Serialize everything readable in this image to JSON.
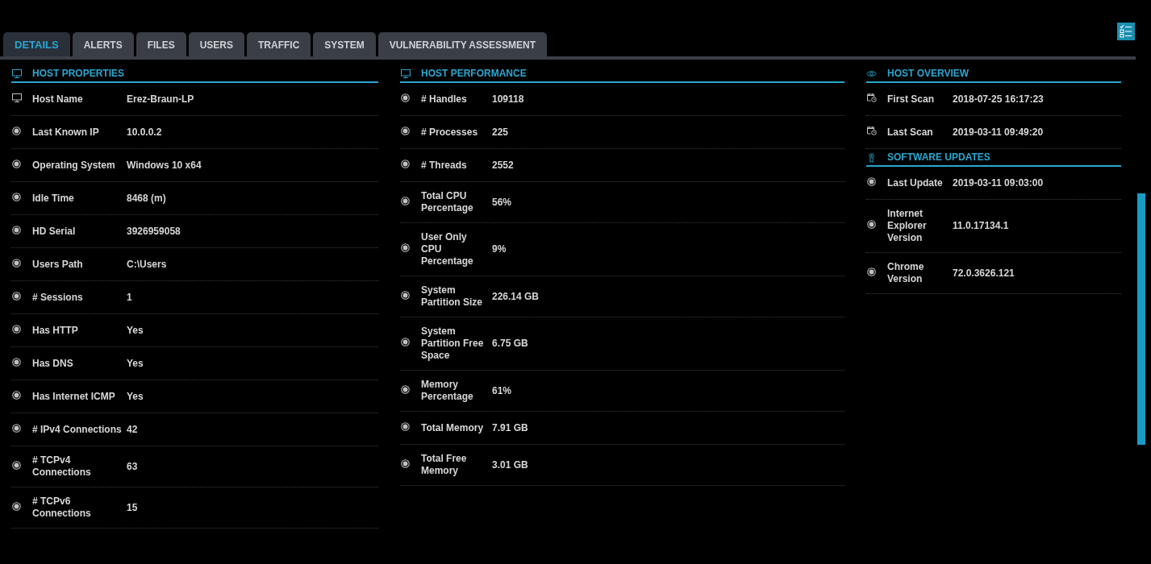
{
  "tabs": [
    {
      "label": "DETAILS",
      "selected": true
    },
    {
      "label": "ALERTS",
      "selected": false
    },
    {
      "label": "FILES",
      "selected": false
    },
    {
      "label": "USERS",
      "selected": false
    },
    {
      "label": "TRAFFIC",
      "selected": false
    },
    {
      "label": "SYSTEM",
      "selected": false
    },
    {
      "label": "VULNERABILITY ASSESSMENT",
      "selected": false
    }
  ],
  "columns": [
    {
      "sections": [
        {
          "title": "HOST PROPERTIES",
          "kind": "monitor",
          "rows": [
            {
              "kind": "monitor",
              "label": "Host Name",
              "value": "Erez-Braun-LP"
            },
            {
              "kind": "dot",
              "label": "Last Known IP",
              "value": "10.0.0.2"
            },
            {
              "kind": "dot",
              "label": "Operating System",
              "value": "Windows 10 x64"
            },
            {
              "kind": "dot",
              "label": "Idle Time",
              "value": "8468 (m)"
            },
            {
              "kind": "dot",
              "label": "HD Serial",
              "value": "3926959058"
            },
            {
              "kind": "dot",
              "label": "Users Path",
              "value": "C:\\Users"
            },
            {
              "kind": "dot",
              "label": "# Sessions",
              "value": "1"
            },
            {
              "kind": "dot",
              "label": "Has HTTP",
              "value": "Yes"
            },
            {
              "kind": "dot",
              "label": "Has DNS",
              "value": "Yes"
            },
            {
              "kind": "dot",
              "label": "Has Internet ICMP",
              "value": "Yes"
            },
            {
              "kind": "dot",
              "label": "# IPv4 Connections",
              "value": "42"
            },
            {
              "kind": "dot",
              "label": "# TCPv4 Connections",
              "value": "63"
            },
            {
              "kind": "dot",
              "label": "# TCPv6 Connections",
              "value": "15"
            }
          ]
        }
      ]
    },
    {
      "sections": [
        {
          "title": "HOST PERFORMANCE",
          "kind": "monitor",
          "rows": [
            {
              "kind": "dot",
              "label": "# Handles",
              "value": "109118"
            },
            {
              "kind": "dot",
              "label": "# Processes",
              "value": "225"
            },
            {
              "kind": "dot",
              "label": "# Threads",
              "value": "2552"
            },
            {
              "kind": "dot",
              "label": "Total CPU Percentage",
              "value": "56%"
            },
            {
              "kind": "dot",
              "label": "User Only CPU Percentage",
              "value": "9%"
            },
            {
              "kind": "dot",
              "label": "System Partition Size",
              "value": "226.14 GB"
            },
            {
              "kind": "dot",
              "label": "System Partition Free Space",
              "value": "6.75 GB"
            },
            {
              "kind": "dot",
              "label": "Memory Percentage",
              "value": "61%"
            },
            {
              "kind": "dot",
              "label": "Total Memory",
              "value": "7.91 GB"
            },
            {
              "kind": "dot",
              "label": "Total Free Memory",
              "value": "3.01 GB"
            }
          ]
        }
      ]
    },
    {
      "sections": [
        {
          "title": "HOST OVERVIEW",
          "kind": "eye",
          "rows": [
            {
              "kind": "calendar",
              "label": "First Scan",
              "value": "2018-07-25 16:17:23"
            },
            {
              "kind": "calendar",
              "label": "Last Scan",
              "value": "2019-03-11 09:49:20"
            }
          ]
        },
        {
          "title": "SOFTWARE UPDATES",
          "kind": "ribbon",
          "rows": [
            {
              "kind": "dot",
              "label": "Last Update",
              "value": "2019-03-11 09:03:00"
            },
            {
              "kind": "dot",
              "label": "Internet Explorer Version",
              "value": "11.0.17134.1"
            },
            {
              "kind": "dot",
              "label": "Chrome Version",
              "value": "72.0.3626.121"
            }
          ]
        }
      ]
    }
  ]
}
